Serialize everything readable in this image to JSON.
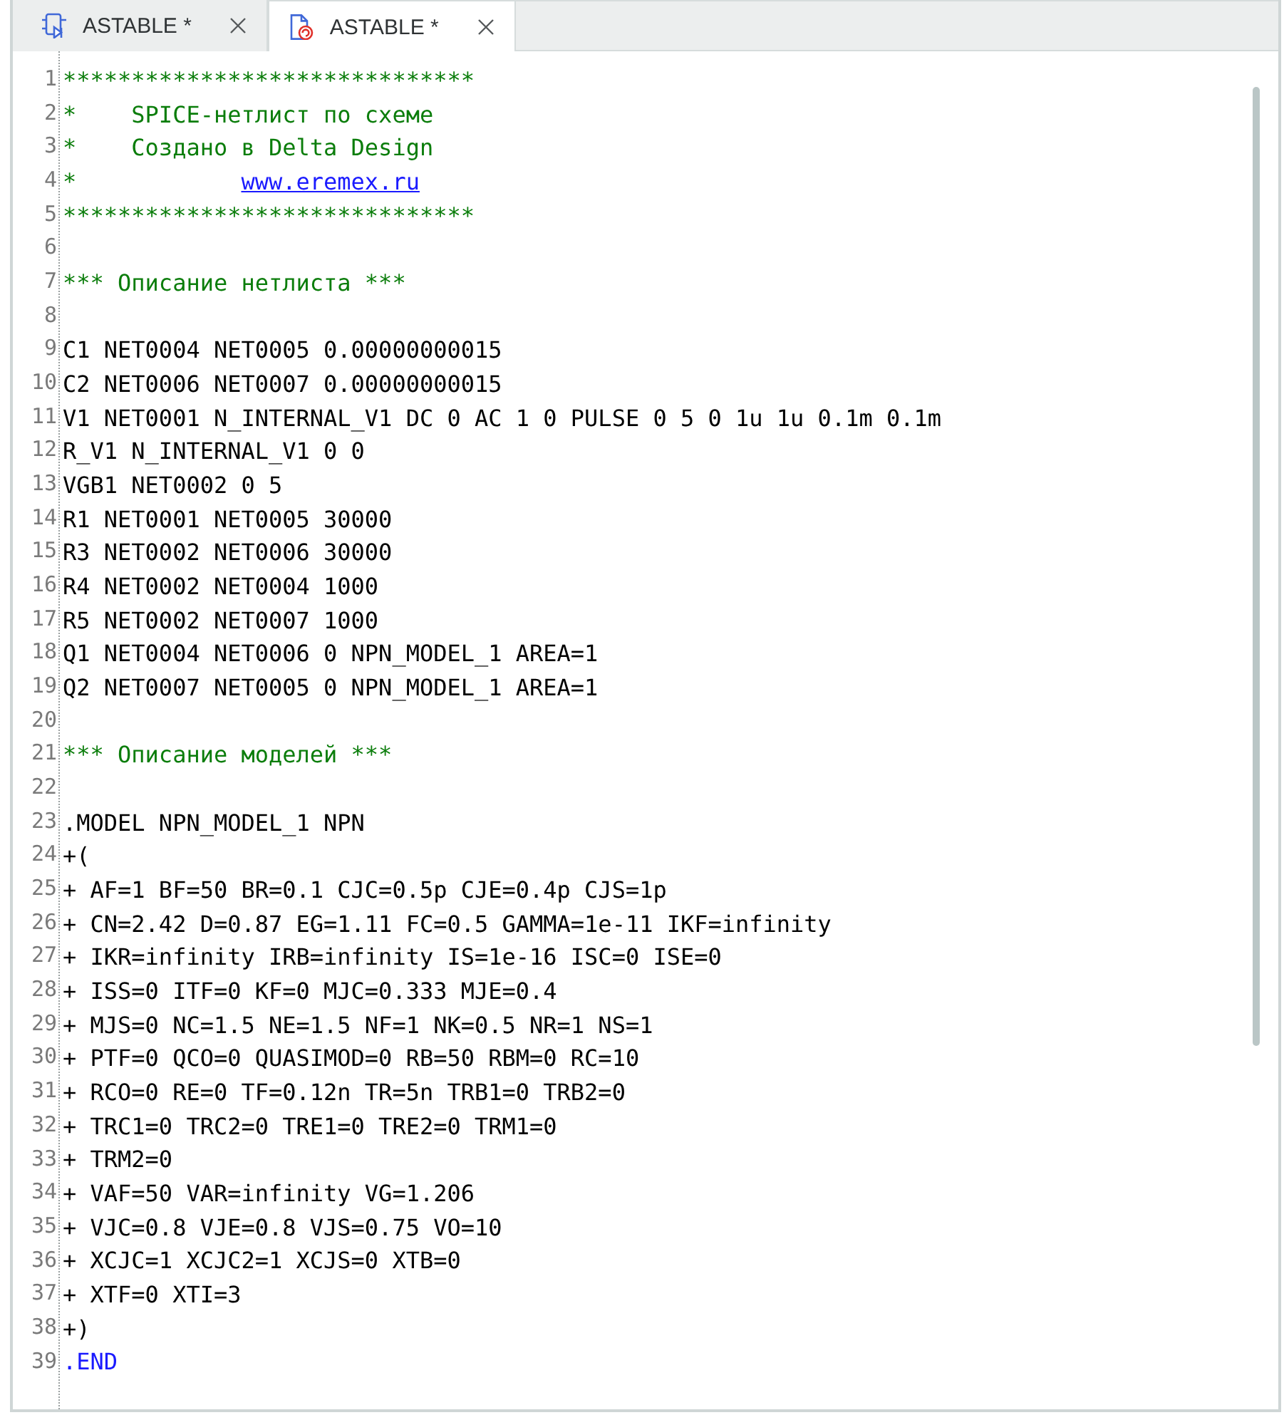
{
  "tabs": [
    {
      "label": "ASTABLE *",
      "kind": "schematic",
      "selected": false
    },
    {
      "label": "ASTABLE *",
      "kind": "netlist",
      "selected": true
    }
  ],
  "editor": {
    "lines": [
      {
        "number": "1",
        "segments": [
          {
            "kind": "comment",
            "text": "******************************"
          }
        ]
      },
      {
        "number": "2",
        "segments": [
          {
            "kind": "comment",
            "text": "*    SPICE-нетлист по схеме"
          }
        ]
      },
      {
        "number": "3",
        "segments": [
          {
            "kind": "comment",
            "text": "*    Создано в Delta Design"
          }
        ]
      },
      {
        "number": "4",
        "segments": [
          {
            "kind": "comment",
            "text": "*            "
          },
          {
            "kind": "link",
            "text": "www.eremex.ru"
          }
        ]
      },
      {
        "number": "5",
        "segments": [
          {
            "kind": "comment",
            "text": "******************************"
          }
        ]
      },
      {
        "number": "6"
      },
      {
        "number": "7",
        "segments": [
          {
            "kind": "comment",
            "text": "*** Описание нетлиста ***"
          }
        ]
      },
      {
        "number": "8"
      },
      {
        "number": "9",
        "segments": [
          {
            "kind": "plain",
            "text": "C1 NET0004 NET0005 0.00000000015"
          }
        ]
      },
      {
        "number": "10",
        "segments": [
          {
            "kind": "plain",
            "text": "C2 NET0006 NET0007 0.00000000015"
          }
        ]
      },
      {
        "number": "11",
        "segments": [
          {
            "kind": "plain",
            "text": "V1 NET0001 N_INTERNAL_V1 DC 0 AC 1 0 PULSE 0 5 0 1u 1u 0.1m 0.1m"
          }
        ]
      },
      {
        "number": "12",
        "segments": [
          {
            "kind": "plain",
            "text": "R_V1 N_INTERNAL_V1 0 0"
          }
        ]
      },
      {
        "number": "13",
        "segments": [
          {
            "kind": "plain",
            "text": "VGB1 NET0002 0 5"
          }
        ]
      },
      {
        "number": "14",
        "segments": [
          {
            "kind": "plain",
            "text": "R1 NET0001 NET0005 30000"
          }
        ]
      },
      {
        "number": "15",
        "segments": [
          {
            "kind": "plain",
            "text": "R3 NET0002 NET0006 30000"
          }
        ]
      },
      {
        "number": "16",
        "segments": [
          {
            "kind": "plain",
            "text": "R4 NET0002 NET0004 1000"
          }
        ]
      },
      {
        "number": "17",
        "segments": [
          {
            "kind": "plain",
            "text": "R5 NET0002 NET0007 1000"
          }
        ]
      },
      {
        "number": "18",
        "segments": [
          {
            "kind": "plain",
            "text": "Q1 NET0004 NET0006 0 NPN_MODEL_1 AREA=1"
          }
        ]
      },
      {
        "number": "19",
        "segments": [
          {
            "kind": "plain",
            "text": "Q2 NET0007 NET0005 0 NPN_MODEL_1 AREA=1"
          }
        ]
      },
      {
        "number": "20"
      },
      {
        "number": "21",
        "segments": [
          {
            "kind": "comment",
            "text": "*** Описание моделей ***"
          }
        ]
      },
      {
        "number": "22"
      },
      {
        "number": "23",
        "segments": [
          {
            "kind": "plain",
            "text": ".MODEL NPN_MODEL_1 NPN"
          }
        ]
      },
      {
        "number": "24",
        "segments": [
          {
            "kind": "plain",
            "text": "+("
          }
        ]
      },
      {
        "number": "25",
        "segments": [
          {
            "kind": "plain",
            "text": "+ AF=1 BF=50 BR=0.1 CJC=0.5p CJE=0.4p CJS=1p"
          }
        ]
      },
      {
        "number": "26",
        "segments": [
          {
            "kind": "plain",
            "text": "+ CN=2.42 D=0.87 EG=1.11 FC=0.5 GAMMA=1e-11 IKF=infinity"
          }
        ]
      },
      {
        "number": "27",
        "segments": [
          {
            "kind": "plain",
            "text": "+ IKR=infinity IRB=infinity IS=1e-16 ISC=0 ISE=0"
          }
        ]
      },
      {
        "number": "28",
        "segments": [
          {
            "kind": "plain",
            "text": "+ ISS=0 ITF=0 KF=0 MJC=0.333 MJE=0.4"
          }
        ]
      },
      {
        "number": "29",
        "segments": [
          {
            "kind": "plain",
            "text": "+ MJS=0 NC=1.5 NE=1.5 NF=1 NK=0.5 NR=1 NS=1"
          }
        ]
      },
      {
        "number": "30",
        "segments": [
          {
            "kind": "plain",
            "text": "+ PTF=0 QCO=0 QUASIMOD=0 RB=50 RBM=0 RC=10"
          }
        ]
      },
      {
        "number": "31",
        "segments": [
          {
            "kind": "plain",
            "text": "+ RCO=0 RE=0 TF=0.12n TR=5n TRB1=0 TRB2=0"
          }
        ]
      },
      {
        "number": "32",
        "segments": [
          {
            "kind": "plain",
            "text": "+ TRC1=0 TRC2=0 TRE1=0 TRE2=0 TRM1=0"
          }
        ]
      },
      {
        "number": "33",
        "segments": [
          {
            "kind": "plain",
            "text": "+ TRM2=0"
          }
        ]
      },
      {
        "number": "34",
        "segments": [
          {
            "kind": "plain",
            "text": "+ VAF=50 VAR=infinity VG=1.206"
          }
        ]
      },
      {
        "number": "35",
        "segments": [
          {
            "kind": "plain",
            "text": "+ VJC=0.8 VJE=0.8 VJS=0.75 VO=10"
          }
        ]
      },
      {
        "number": "36",
        "segments": [
          {
            "kind": "plain",
            "text": "+ XCJC=1 XCJC2=1 XCJS=0 XTB=0"
          }
        ]
      },
      {
        "number": "37",
        "segments": [
          {
            "kind": "plain",
            "text": "+ XTF=0 XTI=3"
          }
        ]
      },
      {
        "number": "38",
        "segments": [
          {
            "kind": "plain",
            "text": "+)"
          }
        ]
      },
      {
        "number": "39",
        "segments": [
          {
            "kind": "keyword",
            "text": ".END"
          }
        ]
      }
    ]
  }
}
